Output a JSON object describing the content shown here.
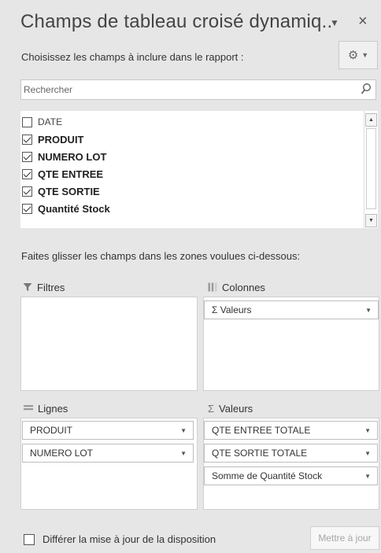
{
  "header": {
    "title": "Champs de tableau croisé dynamiq..",
    "dropdown_glyph": "▼",
    "close_glyph": "×"
  },
  "chooser": {
    "label": "Choisissez les champs à inclure dans le rapport :",
    "gear_glyph": "⚙",
    "gear_dd_glyph": "▼"
  },
  "search": {
    "placeholder": "Rechercher"
  },
  "fields": [
    {
      "label": "DATE",
      "checked": false
    },
    {
      "label": "PRODUIT",
      "checked": true
    },
    {
      "label": "NUMERO LOT",
      "checked": true
    },
    {
      "label": "QTE ENTREE",
      "checked": true
    },
    {
      "label": "QTE SORTIE",
      "checked": true
    },
    {
      "label": "Quantité Stock",
      "checked": true
    }
  ],
  "scrollbar": {
    "up_glyph": "▲",
    "down_glyph": "▼"
  },
  "areas": {
    "instruction": "Faites glisser les champs dans les zones voulues ci-dessous:",
    "filters": {
      "label": "Filtres",
      "items": []
    },
    "columns": {
      "label": "Colonnes",
      "items": [
        "Σ  Valeurs"
      ]
    },
    "rows": {
      "label": "Lignes",
      "items": [
        "PRODUIT",
        "NUMERO LOT"
      ]
    },
    "values": {
      "label": "Valeurs",
      "sigma": "Σ",
      "items": [
        "QTE ENTREE TOTALE",
        "QTE SORTIE TOTALE",
        "Somme de Quantité Stock"
      ]
    },
    "pill_arrow": "▼"
  },
  "footer": {
    "defer_label": "Différer la mise à jour de la disposition",
    "defer_checked": false,
    "update_label": "Mettre à jour"
  }
}
